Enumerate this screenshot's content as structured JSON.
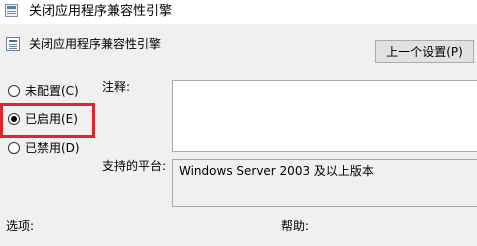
{
  "window": {
    "title": "关闭应用程序兼容性引擎",
    "icon": "policy-window-icon"
  },
  "header": {
    "policy_name": "关闭应用程序兼容性引擎",
    "icon": "policy-setting-icon",
    "prev_button": "上一个设置(P)"
  },
  "state_options": [
    {
      "label": "未配置(C)",
      "checked": false
    },
    {
      "label": "已启用(E)",
      "checked": true
    },
    {
      "label": "已禁用(D)",
      "checked": false
    }
  ],
  "highlight_color": "#e5232a",
  "comment": {
    "label": "注释:",
    "value": ""
  },
  "platform": {
    "label": "支持的平台:",
    "value": "Windows Server 2003 及以上版本"
  },
  "bottom": {
    "options_label": "选项:",
    "help_label": "帮助:"
  }
}
